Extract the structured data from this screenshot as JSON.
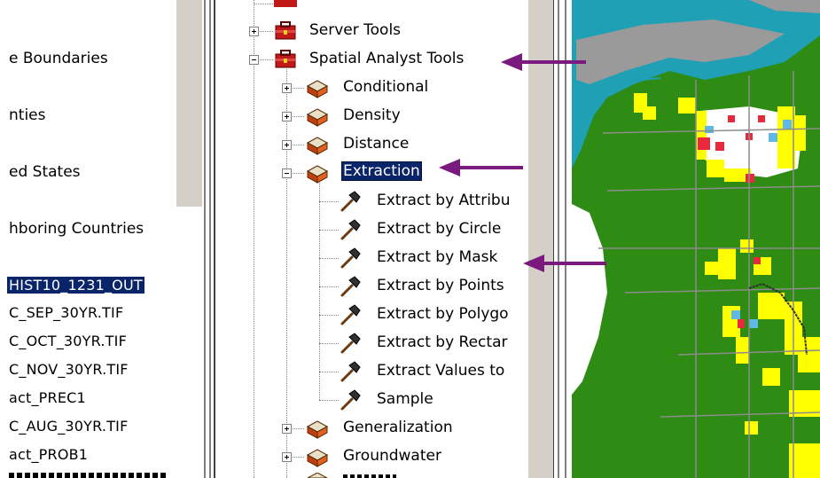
{
  "toc": {
    "layers": [
      "e Boundaries",
      "nties",
      "ed States",
      "hboring Countries"
    ],
    "rasters": [
      "HIST10_1231_OUT",
      "C_SEP_30YR.TIF",
      "C_OCT_30YR.TIF",
      "C_NOV_30YR.TIF",
      "act_PREC1",
      "C_AUG_30YR.TIF",
      "act_PROB1"
    ]
  },
  "tree": {
    "server_tools": "Server Tools",
    "spatial_analyst": "Spatial Analyst Tools",
    "conditional": "Conditional",
    "density": "Density",
    "distance": "Distance",
    "extraction": "Extraction",
    "tools": [
      "Extract by Attribu",
      "Extract by Circle",
      "Extract by Mask",
      "Extract by Points",
      "Extract by Polygo",
      "Extract by Rectar",
      "Extract Values to",
      "Sample"
    ],
    "generalization": "Generalization",
    "groundwater": "Groundwater"
  },
  "colors": {
    "selection": "#0a246a",
    "arrow": "#7b1a7e",
    "map_green": "#2e8b14",
    "map_gray": "#9a9a9a",
    "map_yellow": "#ffff00",
    "map_water": "#1fa0b4"
  }
}
